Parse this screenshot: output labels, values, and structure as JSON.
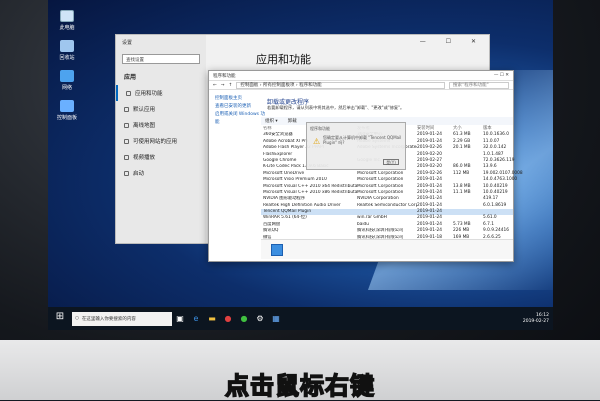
{
  "desktop_icons": [
    "此电脑",
    "回收站",
    "网络",
    "控制面板"
  ],
  "settings": {
    "title": "设置",
    "search_placeholder": "查找设置",
    "section": "应用",
    "nav": [
      "应用和功能",
      "默认应用",
      "离线地图",
      "可使用网站的应用",
      "视频播放",
      "启动"
    ],
    "page_title": "应用和功能"
  },
  "control_panel": {
    "window_title": "程序和功能",
    "breadcrumb": "控制面板 › 所有控制面板项 › 程序和功能",
    "search_placeholder": "搜索\"程序和功能\"",
    "left_links": [
      "控制面板主页",
      "查看已安装的更新",
      "启用或关闭 Windows 功能"
    ],
    "heading": "卸载或更改程序",
    "subtitle": "若要卸载程序，请从列表中将其选中，然后单击\"卸载\"、\"更改\"或\"修复\"。",
    "toolbar": [
      "组织 ▾",
      "卸载"
    ],
    "columns": [
      "名称",
      "发布者",
      "安装时间",
      "大小",
      "版本"
    ],
    "rows": [
      [
        "360安全浏览器",
        "360安全中心",
        "2019-01-24",
        "61.3 MB",
        "10.0.1636.0"
      ],
      [
        "Adobe Acrobat XI Pro",
        "Adobe Systems",
        "2019-01-24",
        "2.29 GB",
        "11.0.07"
      ],
      [
        "Adobe Flash Player 32 PPAPI",
        "Adobe Systems Incorporated",
        "2019-02-26",
        "20.1 MB",
        "32.0.0.142"
      ],
      [
        "FlashExplorer",
        "",
        "2019-02-20",
        "",
        "1.0.1.487"
      ],
      [
        "Google Chrome",
        "Google Inc.",
        "2019-02-27",
        "",
        "72.0.3626.119"
      ],
      [
        "K-Lite Codec Pack 13.9.6 Basic",
        "",
        "2019-02-20",
        "86.0 MB",
        "13.9.6"
      ],
      [
        "Microsoft OneDrive",
        "Microsoft Corporation",
        "2019-02-26",
        "112 MB",
        "19.002.0107.0008"
      ],
      [
        "Microsoft Visio Premium 2010",
        "Microsoft Corporation",
        "2019-01-24",
        "",
        "14.0.4763.1000"
      ],
      [
        "Microsoft Visual C++ 2010 x64 Redistributable - 10.0...",
        "Microsoft Corporation",
        "2019-01-24",
        "13.8 MB",
        "10.0.40219"
      ],
      [
        "Microsoft Visual C++ 2010 x86 Redistributable - 10.0...",
        "Microsoft Corporation",
        "2019-01-24",
        "11.1 MB",
        "10.0.40219"
      ],
      [
        "NVIDIA 图形驱动程序",
        "NVIDIA Corporation",
        "2019-01-24",
        "",
        "419.17"
      ],
      [
        "Realtek High Definition Audio Driver",
        "Realtek Semiconductor Corp.",
        "2019-01-24",
        "",
        "6.0.1.8619"
      ],
      [
        "Tencent QQMail Plugin",
        "",
        "2019-01-24",
        "",
        ""
      ],
      [
        "WinRAR 5.61 (64-位)",
        "win.rar GmbH",
        "2019-01-24",
        "",
        "5.61.0"
      ],
      [
        "百度网盘",
        "baidu",
        "2019-01-24",
        "5.73 MB",
        "6.7.1"
      ],
      [
        "腾讯QQ",
        "腾讯科技(深圳)有限公司",
        "2019-01-24",
        "226 MB",
        "9.0.9.24416"
      ],
      [
        "微信",
        "腾讯科技(深圳)有限公司",
        "2019-01-18",
        "169 MB",
        "2.6.6.25"
      ]
    ],
    "selected_row": 12
  },
  "popup": {
    "title": "程序和功能",
    "text": "您确定要从计算机中卸载 \"Tencent QQMail Plugin\" 吗?",
    "ok": "是(Y)"
  },
  "taskbar": {
    "search_placeholder": "在这里输入你要搜索的内容",
    "time": "16:12",
    "date": "2019-02-27"
  },
  "caption": "点击鼠标右键"
}
